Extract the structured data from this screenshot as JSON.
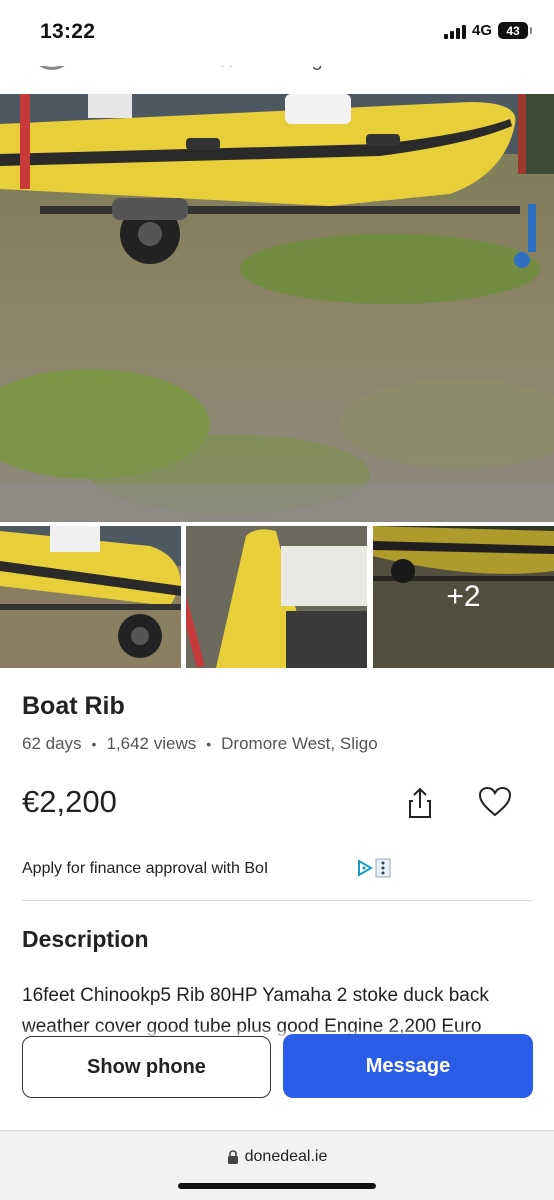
{
  "status_bar": {
    "time": "13:22",
    "network": "4G",
    "battery": "43"
  },
  "seller": {
    "label": "Private seller",
    "rating": "No rating"
  },
  "gallery": {
    "more_count": "+2"
  },
  "listing": {
    "title": "Boat Rib",
    "age": "62 days",
    "views": "1,642 views",
    "location": "Dromore West, Sligo",
    "price": "€2,200",
    "finance_text": "Apply for finance approval with BoI"
  },
  "description": {
    "heading": "Description",
    "text": "16feet Chinookp5 Rib 80HP Yamaha 2 stoke duck back weather cover good tube plus good Engine 2,200 Euro"
  },
  "actions": {
    "show_phone": "Show phone",
    "message": "Message"
  },
  "browser": {
    "url": "donedeal.ie"
  },
  "colors": {
    "primary": "#2b5ee8",
    "boat_yellow": "#e8cf3a"
  }
}
